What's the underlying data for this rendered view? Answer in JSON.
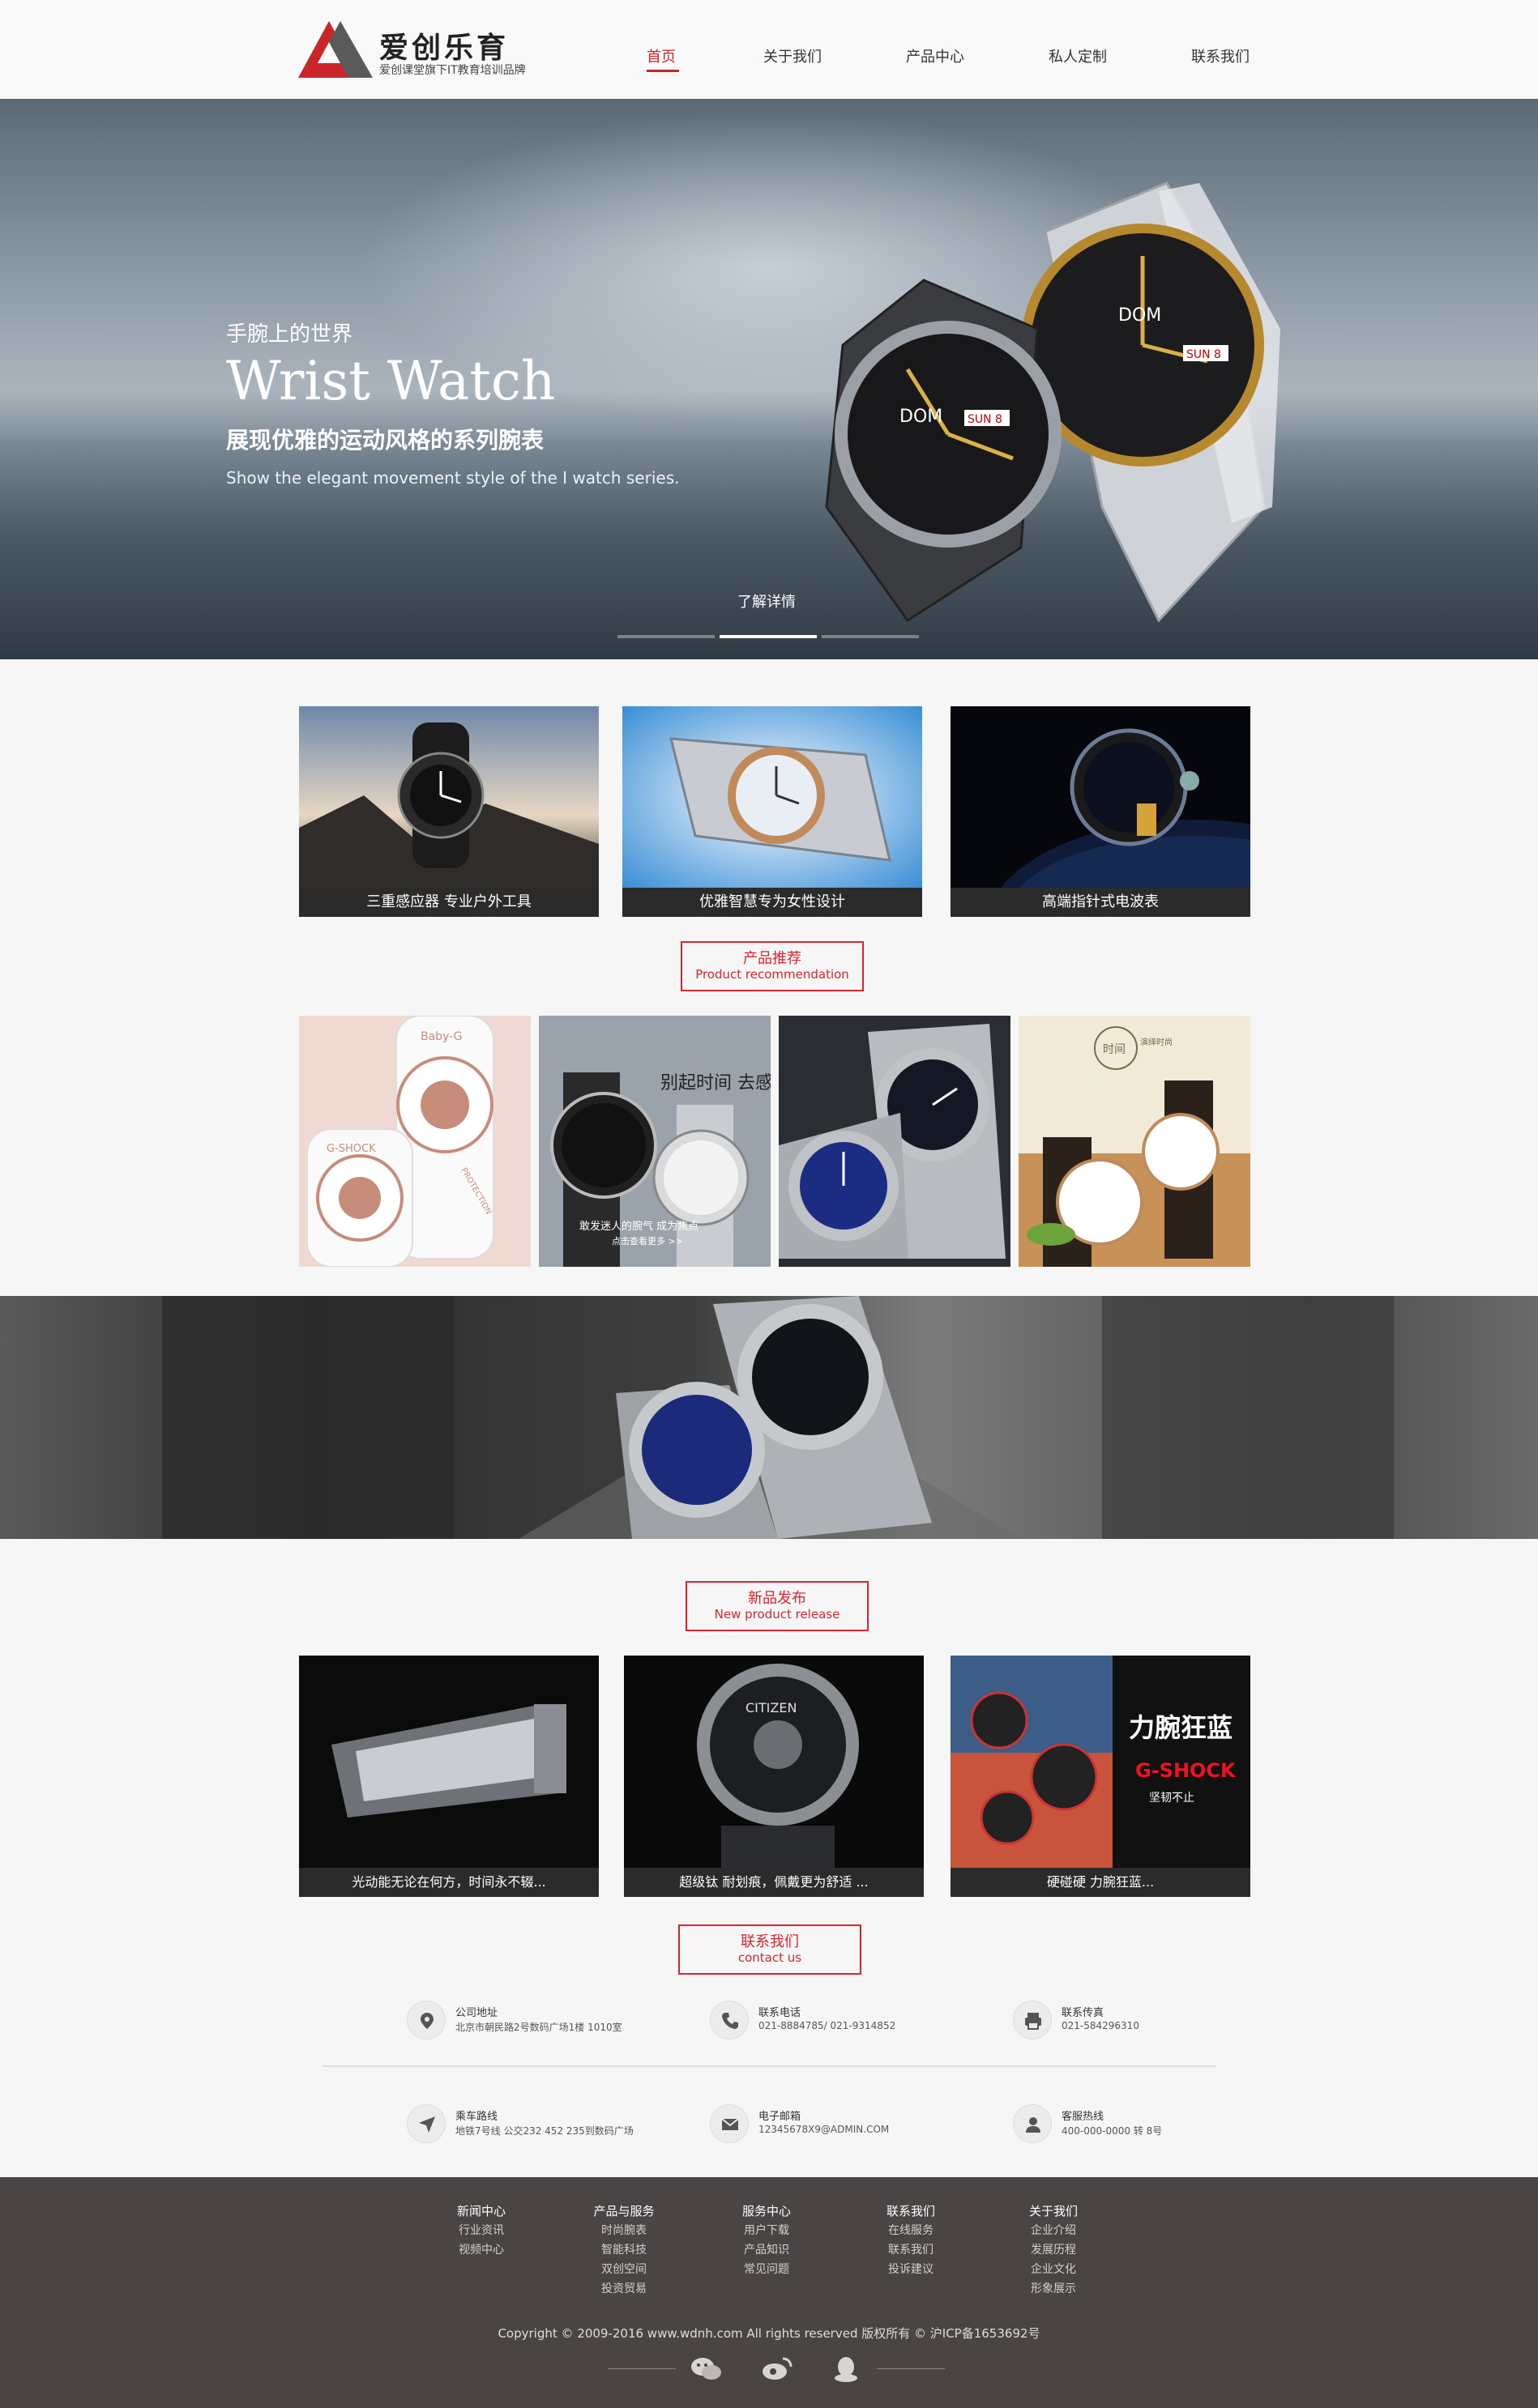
{
  "header": {
    "logo_title": "爱创乐育",
    "logo_subtitle": "爱创课堂旗下IT教育培训品牌",
    "nav": [
      "首页",
      "关于我们",
      "产品中心",
      "私人定制",
      "联系我们"
    ],
    "active_nav": "首页"
  },
  "hero": {
    "kicker": "手腕上的世界",
    "title": "Wrist Watch",
    "subtitle_cn": "展现优雅的运动风格的系列腕表",
    "subtitle_en": "Show the elegant movement style of the I watch series.",
    "button": "了解详情",
    "watch_brand": "DOM",
    "watch_date": "SUN 8",
    "slides": 3,
    "active_slide": 2
  },
  "features": [
    {
      "caption": "三重感应器 专业户外工具"
    },
    {
      "caption": "优雅智慧专为女性设计"
    },
    {
      "caption": "高端指针式电波表"
    }
  ],
  "products_section": {
    "cn": "产品推荐",
    "en": "Product recommendation"
  },
  "products": [
    {
      "brand_text": "Baby-G",
      "model_text": "G-SHOCK",
      "band_text": "PROTECTION"
    },
    {
      "headline": "别起时间 去感受",
      "caption1": "敢发迷人的腕气 成为焦点",
      "caption2": "点击查看更多 >>"
    },
    {},
    {
      "badge_text": "时间",
      "badge_sub": "演绎时尚"
    }
  ],
  "release_section": {
    "cn": "新品发布",
    "en": "New product release"
  },
  "releases": [
    {
      "caption": "光动能无论在何方，时间永不辍..."
    },
    {
      "caption": "超级钛 耐划痕，佩戴更为舒适 ...",
      "brand_text": "CITIZEN"
    },
    {
      "caption": "硬碰硬 力腕狂蓝...",
      "headline": "力腕狂蓝",
      "brand_text": "G-SHOCK",
      "sub_text": "坚韧不止"
    }
  ],
  "contact_section": {
    "cn": "联系我们",
    "en": "contact us"
  },
  "contacts": [
    {
      "icon": "location-pin-icon",
      "title": "公司地址",
      "value": "北京市朝民路2号数码广场1楼 1010室"
    },
    {
      "icon": "phone-icon",
      "title": "联系电话",
      "value": "021-8884785/ 021-9314852"
    },
    {
      "icon": "fax-icon",
      "title": "联系传真",
      "value": "021-584296310"
    },
    {
      "icon": "navigation-arrow-icon",
      "title": "乘车路线",
      "value": "地铁7号线 公交232 452 235到数码广场"
    },
    {
      "icon": "envelope-icon",
      "title": "电子邮箱",
      "value": "12345678X9@ADMIN.COM"
    },
    {
      "icon": "user-service-icon",
      "title": "客服热线",
      "value": "400-000-0000 转 8号"
    }
  ],
  "footer": {
    "columns": [
      {
        "heading": "新闻中心",
        "items": [
          "行业资讯",
          "视频中心"
        ]
      },
      {
        "heading": "产品与服务",
        "items": [
          "时尚腕表",
          "智能科技",
          "双创空间",
          "投资贸易"
        ]
      },
      {
        "heading": "服务中心",
        "items": [
          "用户下载",
          "产品知识",
          "常见问题"
        ]
      },
      {
        "heading": "联系我们",
        "items": [
          "在线服务",
          "联系我们",
          "投诉建议"
        ]
      },
      {
        "heading": "关于我们",
        "items": [
          "企业介绍",
          "发展历程",
          "企业文化",
          "形象展示"
        ]
      }
    ],
    "copyright": "Copyright © 2009-2016 www.wdnh.com All rights reserved  版权所有 ©  沪ICP备1653692号",
    "social": [
      "wechat-icon",
      "weibo-icon",
      "qq-icon"
    ]
  },
  "colors": {
    "accent": "#c9262c",
    "footer_bg": "#4a4544",
    "caption_bg": "#2b2b2b",
    "logo_red": "#c9262c",
    "logo_dark": "#5a5a5a"
  }
}
